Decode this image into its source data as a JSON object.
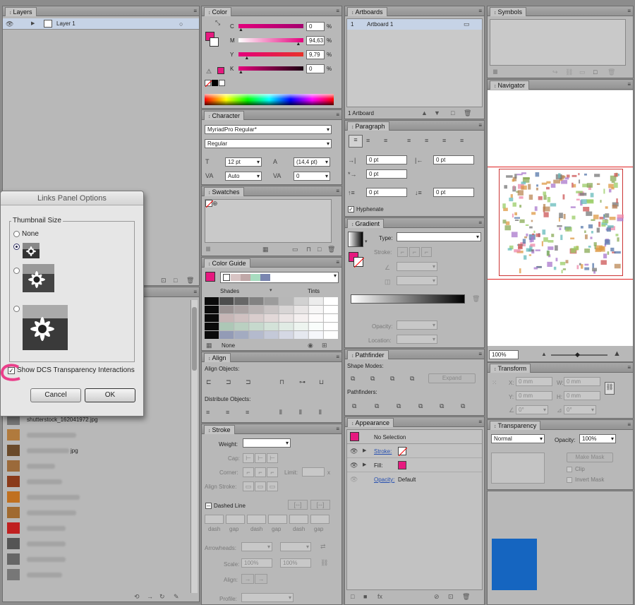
{
  "layers": {
    "tab": "Layers",
    "row_label": "Layer 1"
  },
  "links": {
    "row_text": "shutterstock_162041972.jpg",
    "blur_suffix_1": "jpg"
  },
  "links_options": {
    "title": "Links Panel Options",
    "group_label": "Thumbnail Size",
    "none_label": "None",
    "checkbox_label": "Show DCS Transparency Interactions",
    "cancel_label": "Cancel",
    "ok_label": "OK",
    "selected": "small"
  },
  "color": {
    "tab": "Color",
    "c_label": "C",
    "m_label": "M",
    "y_label": "Y",
    "k_label": "K",
    "c_value": "0",
    "m_value": "94,63",
    "y_value": "9,79",
    "k_value": "0",
    "pct": "%",
    "c_pos": 0,
    "m_pos": 0.946,
    "y_pos": 0.098,
    "k_pos": 0
  },
  "character": {
    "tab": "Character",
    "font_family": "MyriadPro Regular*",
    "font_style": "Regular",
    "size": "12 pt",
    "leading": "(14,4 pt)",
    "kerning": "Auto",
    "tracking": "0"
  },
  "swatches": {
    "tab": "Swatches"
  },
  "color_guide": {
    "tab": "Color Guide",
    "shades_label": "Shades",
    "tints_label": "Tints",
    "none_label": "None"
  },
  "align": {
    "tab": "Align",
    "objects_label": "Align Objects:",
    "distribute_label": "Distribute Objects:"
  },
  "stroke": {
    "tab": "Stroke",
    "weight_label": "Weight:",
    "cap_label": "Cap:",
    "corner_label": "Corner:",
    "limit_label": "Limit:",
    "limit_x": "x",
    "align_label": "Align Stroke:",
    "dashed_label": "Dashed Line",
    "dash_labels": [
      "dash",
      "gap",
      "dash",
      "gap",
      "dash",
      "gap"
    ],
    "arrowheads_label": "Arrowheads:",
    "scale_label": "Scale:",
    "scale1": "100%",
    "scale2": "100%",
    "align2_label": "Align:",
    "profile_label": "Profile:"
  },
  "artboards": {
    "tab": "Artboards",
    "row_num": "1",
    "row_label": "Artboard 1",
    "count_label": "1 Artboard"
  },
  "paragraph": {
    "tab": "Paragraph",
    "left_indent": "0 pt",
    "right_indent": "0 pt",
    "first_indent": "0 pt",
    "space_before": "0 pt",
    "space_after": "0 pt",
    "hyphenate_label": "Hyphenate"
  },
  "gradient": {
    "tab": "Gradient",
    "type_label": "Type:",
    "stroke_label": "Stroke:",
    "opacity_label": "Opacity:",
    "location_label": "Location:"
  },
  "pathfinder": {
    "tab": "Pathfinder",
    "shape_modes_label": "Shape Modes:",
    "expand_label": "Expand",
    "pathfinders_label": "Pathfinders:"
  },
  "appearance": {
    "tab": "Appearance",
    "selection": "No Selection",
    "stroke_label": "Stroke:",
    "fill_label": "Fill:",
    "opacity_label": "Opacity:",
    "opacity_value": "Default"
  },
  "symbols": {
    "tab": "Symbols"
  },
  "navigator": {
    "tab": "Navigator",
    "zoom": "100%"
  },
  "transform": {
    "tab": "Transform",
    "x_label": "X:",
    "y_label": "Y:",
    "w_label": "W:",
    "h_label": "H:",
    "x_val": "0 mm",
    "y_val": "0 mm",
    "w_val": "0 mm",
    "h_val": "0 mm",
    "rot_val": "0°",
    "shear_val": "0°"
  },
  "transparency": {
    "tab": "Transparency",
    "mode": "Normal",
    "opacity_label": "Opacity:",
    "opacity_value": "100%",
    "make_mask": "Make Mask",
    "clip_label": "Clip",
    "invert_label": "Invert Mask"
  },
  "colors": {
    "magenta": "#e6197f",
    "blue": "#1565c0"
  }
}
